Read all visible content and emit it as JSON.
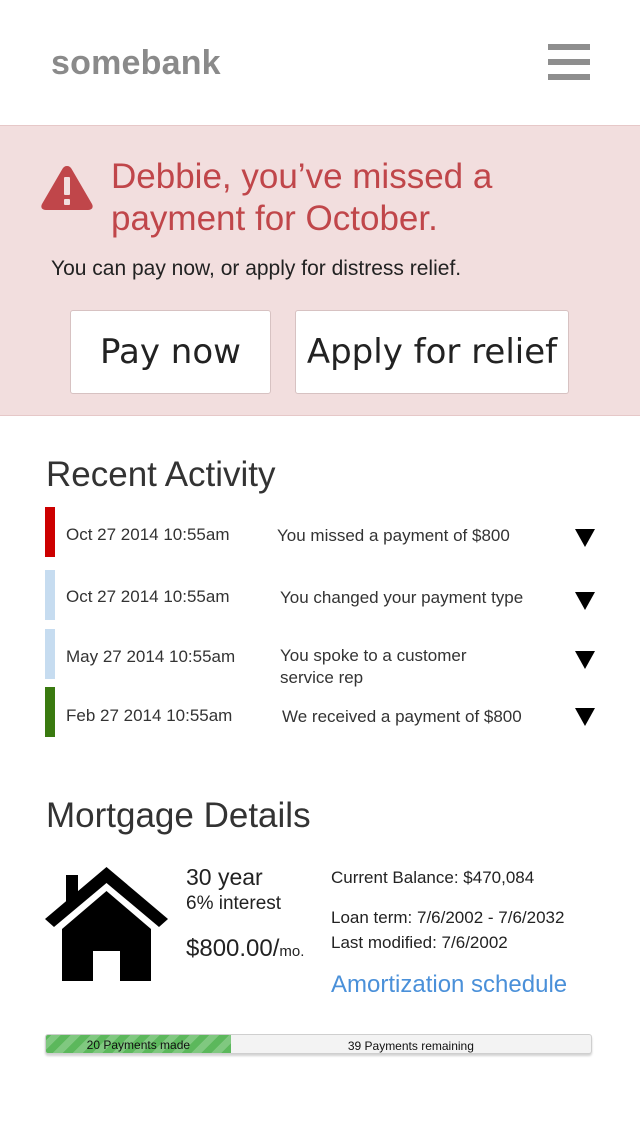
{
  "header": {
    "logo": "somebank",
    "menu_icon": "hamburger-menu-icon"
  },
  "alert": {
    "icon": "warning-triangle-icon",
    "title": "Debbie, you’ve missed a payment for October.",
    "subtitle": "You can pay now, or apply for distress relief.",
    "pay_button": "Pay now",
    "relief_button": "Apply for relief",
    "background": "#f2dede",
    "text_color": "#c0464a"
  },
  "activity": {
    "title": "Recent Activity",
    "items": [
      {
        "date": "Oct 27 2014  10:55am",
        "text": "You missed a payment of $800",
        "status_color": "#cc0000",
        "caret_icon": "caret-down-icon"
      },
      {
        "date": "Oct 27 2014  10:55am",
        "text": "You changed your payment type",
        "status_color": "#c6dcf0",
        "caret_icon": "caret-down-icon"
      },
      {
        "date": "May 27 2014 10:55am",
        "text": "You spoke to a customer service rep",
        "status_color": "#c6dcf0",
        "caret_icon": "caret-down-icon"
      },
      {
        "date": "Feb 27 2014  10:55am",
        "text": "We received a payment of $800",
        "status_color": "#3a7a10",
        "caret_icon": "caret-down-icon"
      }
    ]
  },
  "mortgage": {
    "title": "Mortgage Details",
    "icon": "house-icon",
    "years": "30 year",
    "interest": "6% interest",
    "amount": "$800.00/",
    "amount_unit": "mo.",
    "balance": "Current Balance: $470,084",
    "term": "Loan term: 7/6/2002 - 7/6/2032",
    "modified": "Last modified: 7/6/2002",
    "link": "Amortization schedule",
    "link_color": "#4a90d9"
  },
  "progress": {
    "made_label": "20 Payments made",
    "remaining_label": "39 Payments remaining",
    "payments_made": 20,
    "payments_remaining": 39,
    "fill_color": "#5cb85c"
  }
}
